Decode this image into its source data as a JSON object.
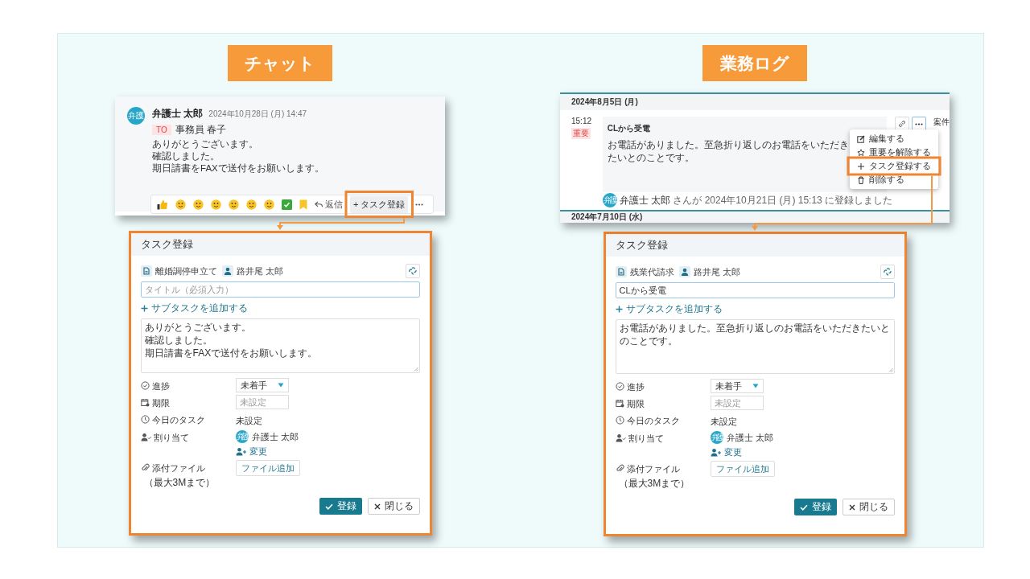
{
  "panels": [
    {
      "kind": "chat",
      "label": "チャット",
      "chat": {
        "avatar": "弁護",
        "author": "弁護士 太郎",
        "timestamp": "2024年10月28日 (月) 14:47",
        "to_badge": "TO",
        "to_name": "事務員 春子",
        "lines": [
          "ありがとうございます。",
          "確認しました。",
          "期日請書をFAXで送付をお願いします。"
        ],
        "reply": "返信",
        "task_button": {
          "label": "+ タスク登録",
          "highlighted": true
        }
      },
      "dialog": {
        "title": "タスク登録",
        "case": "離婚調停申立て",
        "client": "路井尾 太郎",
        "title_field": {
          "placeholder": "タイトル（必須入力）"
        },
        "add_subtask": "サブタスクを追加する",
        "memo_lines": [
          "ありがとうございます。",
          "確認しました。",
          "期日請書をFAXで送付をお願いします。"
        ],
        "rows": [
          {
            "kind": "select",
            "label": "進捗",
            "value": "未着手"
          },
          {
            "kind": "date",
            "label": "期限",
            "placeholder": "未設定"
          },
          {
            "kind": "text",
            "label": "今日のタスク",
            "value": "未設定"
          },
          {
            "kind": "assignee",
            "label": "割り当て",
            "avatar": "弁護",
            "name": "弁護士 太郎",
            "change": "変更"
          },
          {
            "kind": "attachment",
            "label": "添付ファイル",
            "note": "（最大3Mまで）",
            "button": "ファイル追加"
          }
        ],
        "buttons": [
          {
            "kind": "primary",
            "label": "登録"
          },
          {
            "kind": "secondary",
            "label": "閉じる"
          }
        ]
      }
    },
    {
      "kind": "log",
      "label": "業務ログ",
      "log": {
        "date": "2024年8月5日 (月)",
        "time": "15:12",
        "badge": "重要",
        "title": "CLから受電",
        "body": "お電話がありました。至急折り返しのお電話をいただきたいとのことです。",
        "footer_avatar": "弁護",
        "footer_name": "弁護士 太郎",
        "footer_text": "さんが 2024年10月21日 (月) 15:13 に登録しました",
        "side_label": "案件",
        "next_date": "2024年7月10日 (水)",
        "menu": [
          {
            "kind": "edit",
            "label": "編集する",
            "highlighted": false
          },
          {
            "kind": "star",
            "label": "重要を解除する",
            "highlighted": false
          },
          {
            "kind": "plus",
            "label": "タスク登録する",
            "highlighted": true
          },
          {
            "kind": "trash",
            "label": "削除する",
            "highlighted": false
          }
        ]
      },
      "dialog": {
        "title": "タスク登録",
        "case": "残業代請求",
        "client": "路井尾 太郎",
        "title_field": {
          "value": "CLから受電"
        },
        "add_subtask": "サブタスクを追加する",
        "memo_lines": [
          "お電話がありました。至急折り返しのお電話をいただきたいとのことです。"
        ],
        "rows": [
          {
            "kind": "select",
            "label": "進捗",
            "value": "未着手"
          },
          {
            "kind": "date",
            "label": "期限",
            "placeholder": "未設定"
          },
          {
            "kind": "text",
            "label": "今日のタスク",
            "value": "未設定"
          },
          {
            "kind": "assignee",
            "label": "割り当て",
            "avatar": "弁護",
            "name": "弁護士 太郎",
            "change": "変更"
          },
          {
            "kind": "attachment",
            "label": "添付ファイル",
            "note": "（最大3Mまで）",
            "button": "ファイル追加"
          }
        ],
        "buttons": [
          {
            "kind": "primary",
            "label": "登録"
          },
          {
            "kind": "secondary",
            "label": "閉じる"
          }
        ]
      }
    }
  ]
}
